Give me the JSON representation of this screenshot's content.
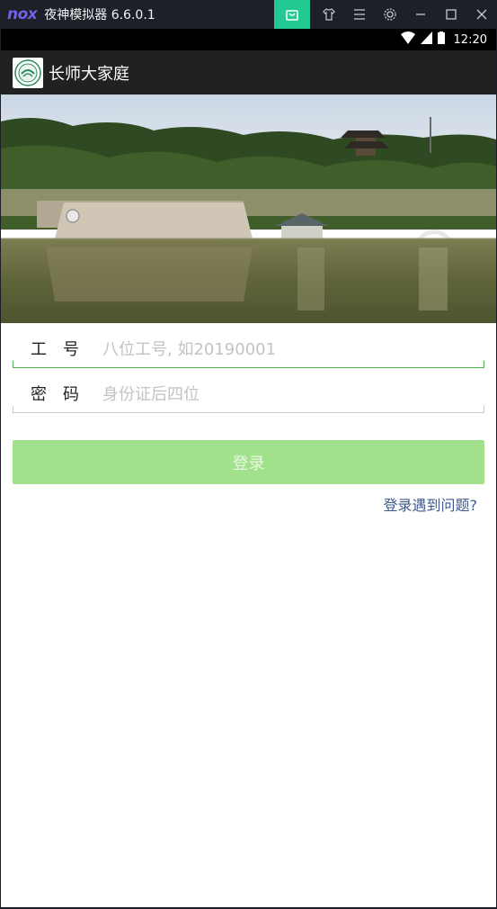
{
  "emulator": {
    "logo": "nox",
    "title": "夜神模拟器 6.6.0.1",
    "controls": [
      "store-icon",
      "shirt-icon",
      "menu-icon",
      "gear-icon",
      "minimize-icon",
      "maximize-icon",
      "close-icon"
    ],
    "accent": "#22c993"
  },
  "statusbar": {
    "time": "12:20"
  },
  "appbar": {
    "title": "长师大家庭"
  },
  "form": {
    "employee_id": {
      "label": "工号",
      "placeholder": "八位工号, 如20190001",
      "value": ""
    },
    "password": {
      "label": "密码",
      "placeholder": "身份证后四位",
      "value": ""
    }
  },
  "login_button": {
    "label": "登录",
    "color": "#a2e18b"
  },
  "help_link": {
    "label": "登录遇到问题?",
    "color": "#3f5a8a"
  }
}
